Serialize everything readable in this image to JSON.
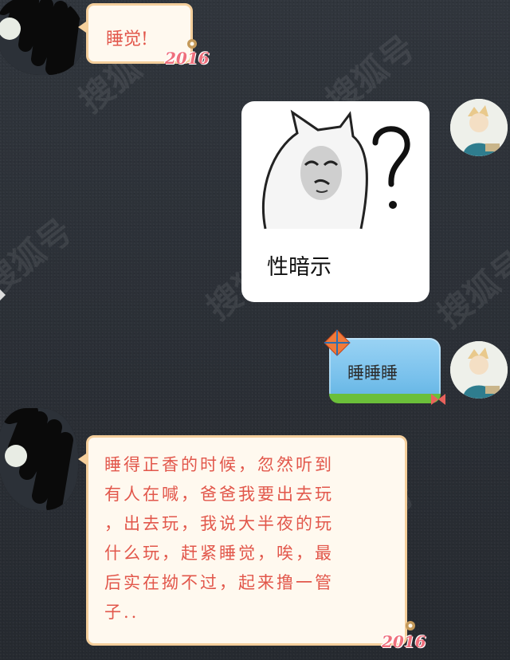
{
  "watermark": "搜狐号",
  "messages": [
    {
      "side": "left",
      "type": "text",
      "text": "睡觉!",
      "badge": "2016"
    },
    {
      "side": "right",
      "type": "sticker",
      "caption": "性暗示"
    },
    {
      "side": "right",
      "type": "text",
      "text": "睡睡睡"
    },
    {
      "side": "left",
      "type": "text",
      "lines": [
        "睡得正香的时候，忽然听到",
        "有人在喊，爸爸我要出去玩",
        "，出去玩，我说大半夜的玩",
        "什么玩，赶紧睡觉，唉，最",
        "后实在拗不过，起来撸一管",
        "子.."
      ],
      "badge": "2016"
    }
  ],
  "colors": {
    "background": "#2c3138",
    "incoming_bubble_bg": "#fff9ef",
    "incoming_bubble_border": "#f5cf9c",
    "incoming_text": "#e2574b",
    "outgoing_bubble": "#79c1ec"
  },
  "icons": [
    "kite-icon",
    "gear-decoration-icon",
    "sticker-image",
    "avatar-image"
  ]
}
